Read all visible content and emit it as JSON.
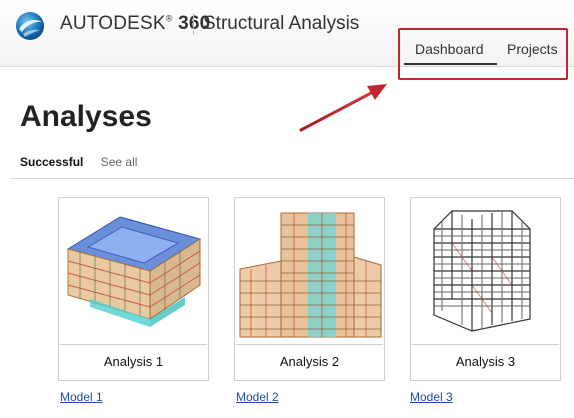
{
  "header": {
    "brand": "AUTODESK",
    "brand_mark": "®",
    "brand_number": "360",
    "product": "Structural Analysis",
    "logo_icon": "autodesk-360-logo-icon"
  },
  "nav": {
    "tabs": [
      {
        "label": "Dashboard",
        "active": true
      },
      {
        "label": "Projects",
        "active": false
      }
    ],
    "highlight_color": "#c0272d"
  },
  "main": {
    "title": "Analyses",
    "filters": [
      {
        "label": "Successful",
        "active": true
      },
      {
        "label": "See all",
        "active": false
      }
    ],
    "cards": [
      {
        "caption": "Analysis 1",
        "model_link": "Model 1",
        "thumbnail_icon": "building-model-1-icon"
      },
      {
        "caption": "Analysis 2",
        "model_link": "Model 2",
        "thumbnail_icon": "building-model-2-icon"
      },
      {
        "caption": "Analysis 3",
        "model_link": "Model 3",
        "thumbnail_icon": "building-model-3-icon"
      }
    ]
  },
  "colors": {
    "link": "#1f4e9c",
    "annotation": "#c0272d"
  }
}
